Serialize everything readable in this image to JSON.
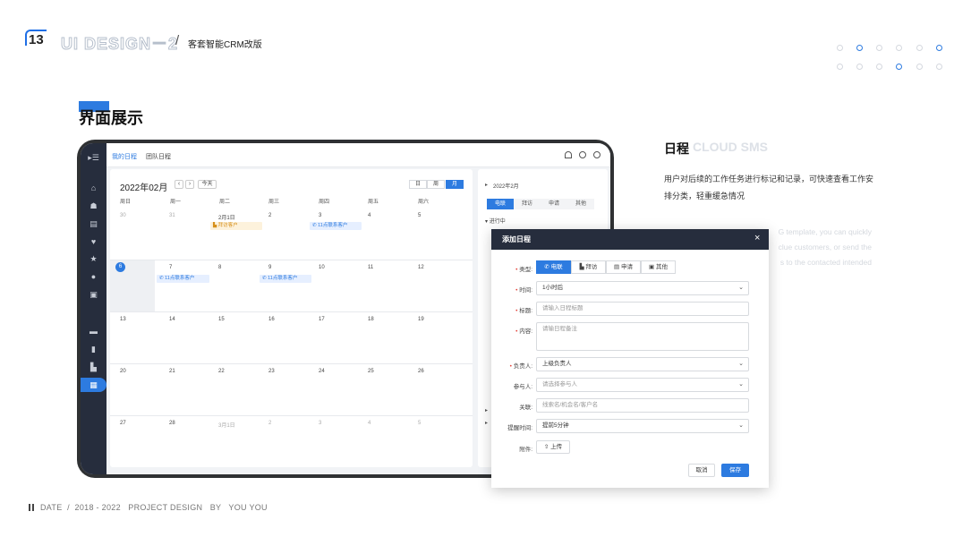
{
  "header": {
    "page_number": "13",
    "title": "UI DESIGN－2",
    "slash": "/",
    "subtitle": "客套智能CRM改版"
  },
  "section": {
    "title": "界面展示"
  },
  "app": {
    "tabs": [
      "我的日程",
      "团队日程"
    ],
    "nav_icons": [
      "menu-icon",
      "home-icon",
      "customer-icon",
      "document-icon",
      "handshake-icon",
      "star-icon",
      "chat-icon",
      "report-icon",
      "briefcase-icon",
      "clipboard-icon",
      "chart-icon",
      "calendar-icon"
    ],
    "calendar": {
      "month": "2022年02月",
      "prev": "‹",
      "next": "›",
      "today_btn": "今天",
      "views": [
        "日",
        "周",
        "月"
      ],
      "active_view": "月",
      "weekdays": [
        "周日",
        "周一",
        "周二",
        "周三",
        "周四",
        "周五",
        "周六"
      ],
      "weeks": [
        [
          "30",
          "31",
          "2月1日",
          "2",
          "3",
          "4",
          "5"
        ],
        [
          "6",
          "7",
          "8",
          "9",
          "10",
          "11",
          "12"
        ],
        [
          "13",
          "14",
          "15",
          "16",
          "17",
          "18",
          "19"
        ],
        [
          "20",
          "21",
          "22",
          "23",
          "24",
          "25",
          "26"
        ],
        [
          "27",
          "28",
          "3月1日",
          "2",
          "3",
          "4",
          "5"
        ]
      ],
      "events": {
        "visit": "拜访客户",
        "call": "11点联系客户"
      }
    },
    "right_panel": {
      "date": "2022年2月",
      "tabs": [
        "电联",
        "拜访",
        "申请",
        "其他"
      ],
      "active_tab": "电联",
      "status": "进行中"
    }
  },
  "modal": {
    "title": "添加日程",
    "close": "×",
    "type_label": "类型:",
    "types": [
      "电联",
      "拜访",
      "申请",
      "其他"
    ],
    "active_type": "电联",
    "time_label": "时间:",
    "time_value": "1小时后",
    "title_label": "标题:",
    "title_placeholder": "请输入日程标题",
    "content_label": "内容:",
    "content_placeholder": "请输日程备注",
    "owner_label": "负责人:",
    "owner_value": "上级负责人",
    "participants_label": "参与人:",
    "participants_placeholder": "请选择参与人",
    "related_label": "关联:",
    "related_placeholder": "线索名/机会名/客户名",
    "reminder_label": "提醒时间:",
    "reminder_value": "提前5分钟",
    "attach_label": "附件:",
    "upload": "上传",
    "cancel": "取消",
    "save": "保存"
  },
  "aside": {
    "title": "日程",
    "title_en": "CLOUD SMS",
    "description": "用户对后续的工作任务进行标记和记录，可快速查看工作安排分类，轻重缓急情况",
    "english": "G template, you can quickly clue customers, or send the s to the contacted intended"
  },
  "footer": {
    "text": "DATE  /  2018 - 2022   PROJECT DESIGN   BY   YOU YOU"
  },
  "colors": {
    "accent": "#2d7be0",
    "sidebar": "#262d3d",
    "event_orange": "#d6901b"
  }
}
